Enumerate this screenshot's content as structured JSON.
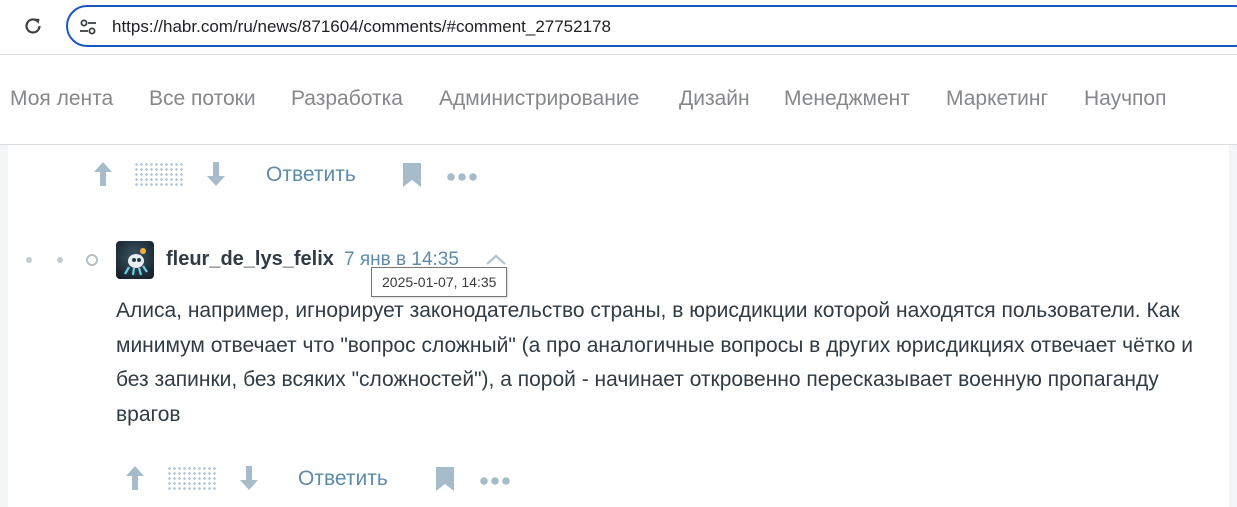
{
  "browser": {
    "url": "https://habr.com/ru/news/871604/comments/#comment_27752178"
  },
  "nav": {
    "items": [
      {
        "label": "Моя лента"
      },
      {
        "label": "Все потоки"
      },
      {
        "label": "Разработка"
      },
      {
        "label": "Администрирование"
      },
      {
        "label": "Дизайн"
      },
      {
        "label": "Менеджмент"
      },
      {
        "label": "Маркетинг"
      },
      {
        "label": "Научпоп"
      }
    ]
  },
  "prev_comment": {
    "reply_label": "Ответить"
  },
  "comment": {
    "author": "fleur_de_lys_felix",
    "date_label": "7 янв в 14:35",
    "date_tooltip": "2025-01-07, 14:35",
    "body": "Алиса, например, игнорирует законодательство страны, в юрисдикции которой находятся пользователи. Как минимум отвечает что \"вопрос сложный\" (а про аналогичные вопросы в других юрисдикциях отвечает чётко и без запинки, без всяких \"сложностей\"), а порой - начинает откровенно пересказывает военную пропаганду врагов",
    "reply_label": "Ответить"
  },
  "icons": {
    "reload": "reload-icon",
    "site_settings": "tune-icon",
    "vote_up": "arrow-up-icon",
    "vote_down": "arrow-down-icon",
    "bookmark": "bookmark-icon",
    "more": "more-dots-icon",
    "collapse": "chevron-up-icon"
  },
  "colors": {
    "accent_link": "#5e8ba8",
    "text": "#303b44",
    "nav_text": "#85878a",
    "icon": "#a6bccb",
    "address_focus": "#1a56c4"
  }
}
